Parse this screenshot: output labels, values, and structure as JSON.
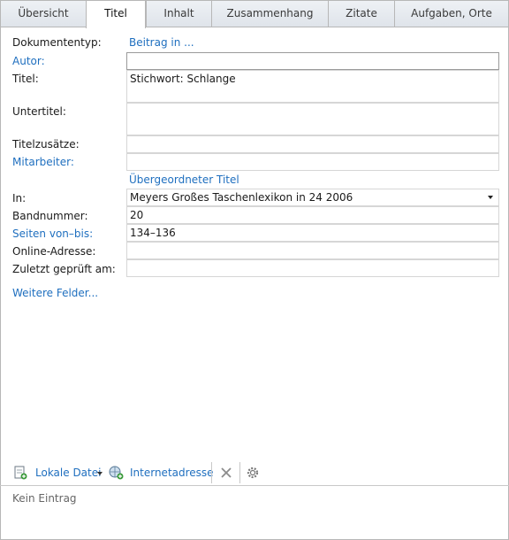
{
  "tabs": [
    "Übersicht",
    "Titel",
    "Inhalt",
    "Zusammenhang",
    "Zitate",
    "Aufgaben, Orte"
  ],
  "form": {
    "dokumententyp_label": "Dokumententyp:",
    "dokumententyp_value": "Beitrag in ...",
    "autor_label": "Autor:",
    "titel_label": "Titel:",
    "titel_value": "Stichwort: Schlange",
    "untertitel_label": "Untertitel:",
    "titelzusaetze_label": "Titelzusätze:",
    "mitarbeiter_label": "Mitarbeiter:",
    "parent_title_heading": "Übergeordneter Titel",
    "in_label": "In:",
    "in_value": "Meyers Großes Taschenlexikon in 24 2006",
    "bandnummer_label": "Bandnummer:",
    "bandnummer_value": "20",
    "seiten_label": "Seiten von–bis:",
    "seiten_value": "134–136",
    "online_label": "Online-Adresse:",
    "zuletzt_label": "Zuletzt geprüft am:",
    "more_fields": "Weitere Felder..."
  },
  "toolbar": {
    "lokale_datei": "Lokale Datei",
    "internetadresse": "Internetadresse",
    "icons": [
      "local-file-icon",
      "dropdown-arrow-icon",
      "web-link-icon",
      "delete-icon",
      "settings-icon"
    ]
  },
  "status": "Kein Eintrag",
  "colors": {
    "link": "#1f6fbf",
    "tab_bg": "#e4e8ee",
    "border": "#b7b7b7"
  }
}
